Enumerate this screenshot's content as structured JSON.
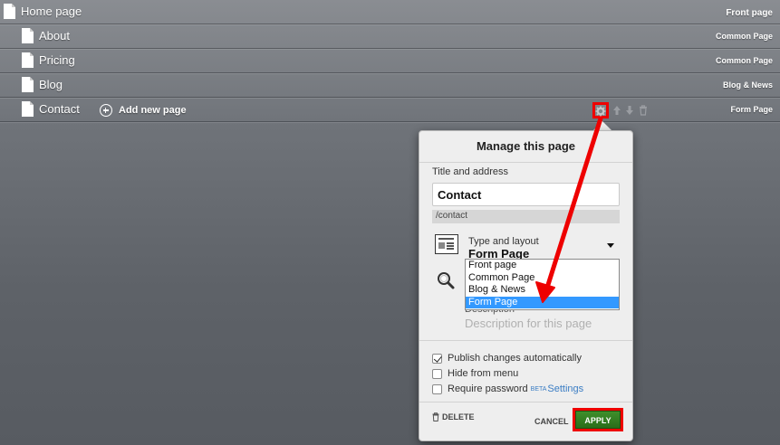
{
  "pages": [
    {
      "title": "Home page",
      "type": "Front page"
    },
    {
      "title": "About",
      "type": "Common Page"
    },
    {
      "title": "Pricing",
      "type": "Common Page"
    },
    {
      "title": "Blog",
      "type": "Blog & News"
    },
    {
      "title": "Contact",
      "type": "Form Page"
    }
  ],
  "add_new_page": "Add new page",
  "dialog": {
    "heading": "Manage this page",
    "title_label": "Title and address",
    "title_value": "Contact",
    "address_value": "/contact",
    "type_label": "Type and layout",
    "type_value": "Form Page",
    "type_options": [
      "Front page",
      "Common Page",
      "Blog & News",
      "Form Page"
    ],
    "type_selected": "Form Page",
    "description_label": "Description",
    "description_placeholder": "Description for this page",
    "options": {
      "publish_auto": {
        "label": "Publish changes automatically",
        "checked": true
      },
      "hide_menu": {
        "label": "Hide from menu",
        "checked": false
      },
      "require_password": {
        "label": "Require password",
        "checked": false,
        "badge": "BETA",
        "link": "Settings"
      }
    },
    "delete_label": "DELETE",
    "cancel_label": "CANCEL",
    "apply_label": "APPLY"
  },
  "colors": {
    "highlight": "#e00000",
    "apply_green": "#2f7d1f",
    "selected_blue": "#3399ff"
  },
  "icons": {
    "page": "page-icon",
    "add": "plus-circle-icon",
    "gear": "gear-icon",
    "move_up": "arrow-up-icon",
    "move_down": "arrow-down-icon",
    "delete": "trash-icon",
    "layout": "layout-icon",
    "seo": "magnifier-icon"
  }
}
